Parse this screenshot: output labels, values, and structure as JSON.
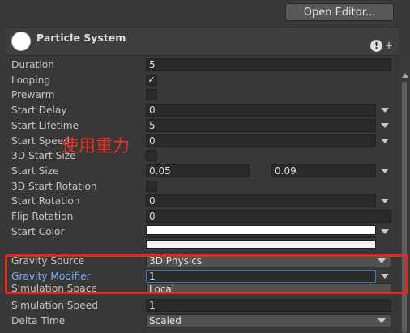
{
  "toolbar": {
    "open_editor_label": "Open Editor..."
  },
  "component": {
    "title": "Particle System",
    "warning_glyph": "!",
    "add_glyph": "+"
  },
  "fields": {
    "duration": {
      "label": "Duration",
      "value": "5"
    },
    "looping": {
      "label": "Looping",
      "checked": true,
      "check_glyph": "✓"
    },
    "prewarm": {
      "label": "Prewarm",
      "checked": false
    },
    "start_delay": {
      "label": "Start Delay",
      "value": "0"
    },
    "start_lifetime": {
      "label": "Start Lifetime",
      "value": "5"
    },
    "start_speed": {
      "label": "Start Speed",
      "value": "0"
    },
    "start_size_3d": {
      "label": "3D Start Size",
      "checked": false
    },
    "start_size": {
      "label": "Start Size",
      "min": "0.05",
      "max": "0.09"
    },
    "start_rotation_3d": {
      "label": "3D Start Rotation",
      "checked": false
    },
    "start_rotation": {
      "label": "Start Rotation",
      "value": "0"
    },
    "flip_rotation": {
      "label": "Flip Rotation",
      "value": "0"
    },
    "start_color": {
      "label": "Start Color",
      "color": "#ffffff"
    },
    "gravity_source": {
      "label": "Gravity Source",
      "value": "3D Physics"
    },
    "gravity_modifier": {
      "label": "Gravity Modifier",
      "value": "1"
    },
    "simulation_space": {
      "label": "Simulation Space",
      "value": "Local"
    },
    "simulation_speed": {
      "label": "Simulation Speed",
      "value": "1"
    },
    "delta_time": {
      "label": "Delta Time",
      "value": "Scaled"
    }
  },
  "annotation": {
    "text": "使用重力",
    "color": "#e5271f"
  },
  "colors": {
    "background": "#383838",
    "field": "#2a2a2a",
    "accent_label": "#7bb0f0",
    "highlight": "#e5271f"
  }
}
